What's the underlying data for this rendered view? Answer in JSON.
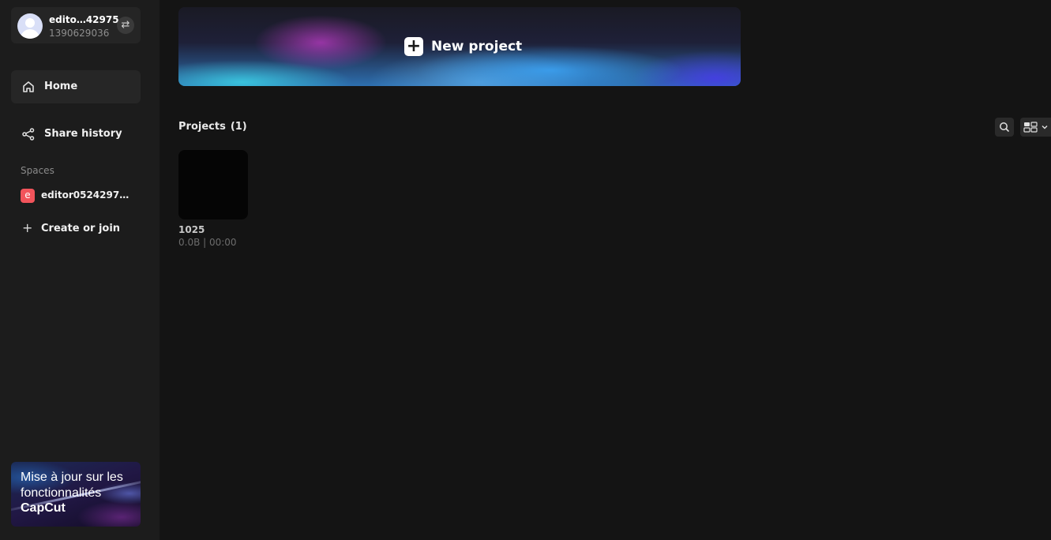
{
  "account": {
    "name": "edito…42975",
    "id": "1390629036",
    "switch_icon": "⇄"
  },
  "nav": {
    "home_label": "Home",
    "share_history_label": "Share history"
  },
  "spaces": {
    "section_label": "Spaces",
    "items": [
      {
        "badge": "e",
        "name": "editor05242975’…",
        "badge_color": "#f2545b"
      }
    ],
    "create_join_label": "Create or join"
  },
  "promo": {
    "text": "Mise à jour sur les fonctionnalités",
    "brand": "CapCut"
  },
  "banner": {
    "plus": "+",
    "label": "New project"
  },
  "projects": {
    "title": "Projects",
    "count": "(1)",
    "items": [
      {
        "name": "1025",
        "meta": "0.0B | 00:00"
      }
    ]
  },
  "colors": {
    "background": "#141414",
    "sidebar": "#1c1c1c",
    "active_nav": "#262626",
    "space_badge": "#f2545b"
  }
}
